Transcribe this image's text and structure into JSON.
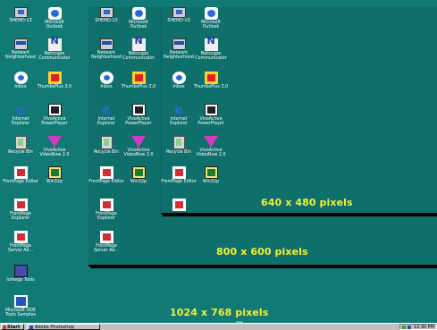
{
  "resolutions": {
    "label_640": "640 x 480 pixels",
    "label_800": "800 x 600 pixels",
    "label_1024": "1024 x 768 pixels"
  },
  "icons": {
    "my_computer": "SHEMD-13",
    "outlook": "Microsoft Outlook",
    "network": "Network Neighborhood",
    "netscape": "Netscape Communicator",
    "inbox": "Inbox",
    "thumbsplus": "ThumbsPlus 3.0",
    "ie": "Internet Explorer",
    "poweplayer": "VivoActive PowerPlayer",
    "recycle": "Recycle Bin",
    "videonow": "VivoActive VideoNow 2.0",
    "fp_editor": "FrontPage Editor",
    "win32": "Win32p",
    "fp_explorer": "FrontPage Explorer",
    "fp_server": "FrontPage Server Ad...",
    "iomega": "Iomega Tools",
    "ms_ode": "Microsoft ODE Tools Samples"
  },
  "taskbar": {
    "start": "Start",
    "task": "Adobe Photoshop",
    "clock": "12:30 PM"
  },
  "colors": {
    "desktop": "#127a75",
    "label": "#f2ef34"
  }
}
